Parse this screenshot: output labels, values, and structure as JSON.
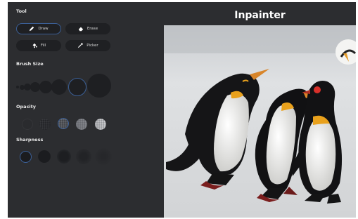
{
  "app": {
    "title": "Inpainter"
  },
  "tool": {
    "label": "Tool",
    "buttons": [
      {
        "label": "Draw",
        "icon": "pencil-icon",
        "active": true
      },
      {
        "label": "Erase",
        "icon": "eraser-icon",
        "active": false
      },
      {
        "label": "Fill",
        "icon": "paint-bucket-icon",
        "active": false
      },
      {
        "label": "Picker",
        "icon": "eyedropper-icon",
        "active": false
      }
    ]
  },
  "brush_size": {
    "label": "Brush Size",
    "options": 7,
    "selected_index": 5
  },
  "opacity": {
    "label": "Opacity",
    "options": 5,
    "selected_index": 2
  },
  "sharpness": {
    "label": "Sharpness",
    "options": 5,
    "selected_index": 0
  },
  "colors": {
    "accent": "#3b5f96",
    "panel": "#2c2d30",
    "control": "#1e1f22"
  }
}
